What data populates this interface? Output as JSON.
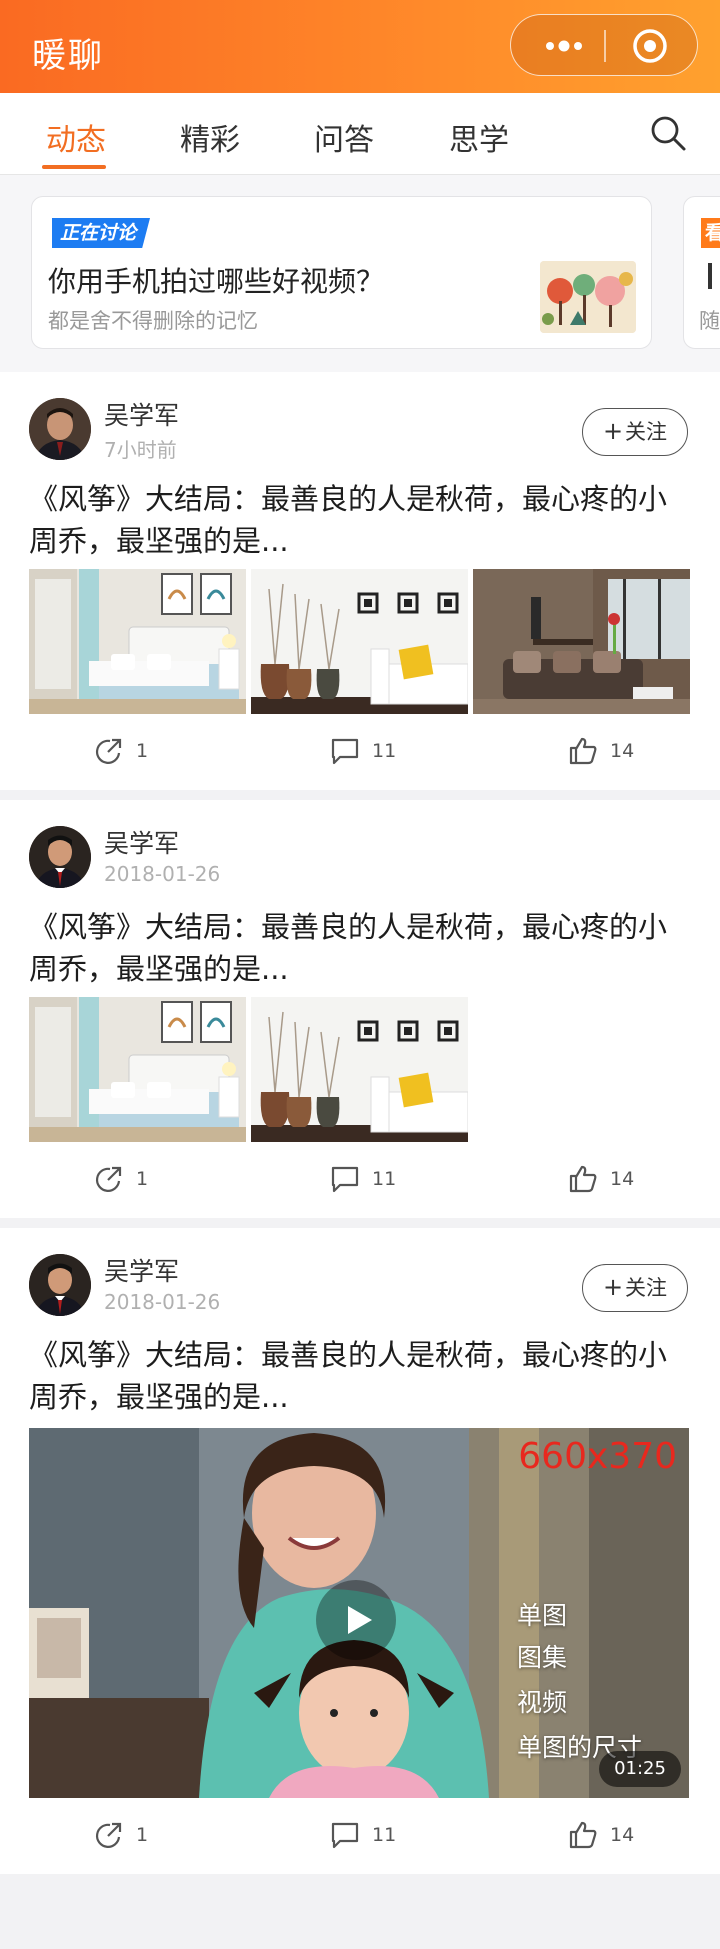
{
  "header": {
    "app_title": "暖聊",
    "menu_icon": "more-dots-icon",
    "record_icon": "record-circle-icon"
  },
  "tabs": [
    {
      "label": "动态",
      "active": true
    },
    {
      "label": "精彩",
      "active": false
    },
    {
      "label": "问答",
      "active": false
    },
    {
      "label": "思学",
      "active": false
    }
  ],
  "discussion": {
    "badge": "正在讨论",
    "title": "你用手机拍过哪些好视频？",
    "subtitle": "都是舍不得删除的记忆",
    "next_badge": "看",
    "next_subtitle": "随"
  },
  "posts": [
    {
      "author": "吴学军",
      "time": "7小时前",
      "follow_label": "关注",
      "title": "《风筝》大结局：最善良的人是秋荷，最心疼的小周乔，最坚强的是...",
      "media": "images-3",
      "shares": "1",
      "comments": "11",
      "likes": "14"
    },
    {
      "author": "吴学军",
      "time": "2018-01-26",
      "title": "《风筝》大结局：最善良的人是秋荷，最心疼的小周乔，最坚强的是...",
      "media": "images-2",
      "shares": "1",
      "comments": "11",
      "likes": "14"
    },
    {
      "author": "吴学军",
      "time": "2018-01-26",
      "follow_label": "关注",
      "title": "《风筝》大结局：最善良的人是秋荷，最心疼的小周乔，最坚强的是...",
      "media": "video",
      "video": {
        "size_label": "660x370",
        "overlay_lines": [
          "单图",
          "图集",
          "视频",
          "单图的尺寸"
        ],
        "duration": "01:25"
      },
      "shares": "1",
      "comments": "11",
      "likes": "14"
    }
  ],
  "colors": {
    "accent": "#f26e22",
    "badge_blue": "#1d7cf2",
    "header_start": "#fa6a22",
    "header_end": "#ffa12e"
  }
}
